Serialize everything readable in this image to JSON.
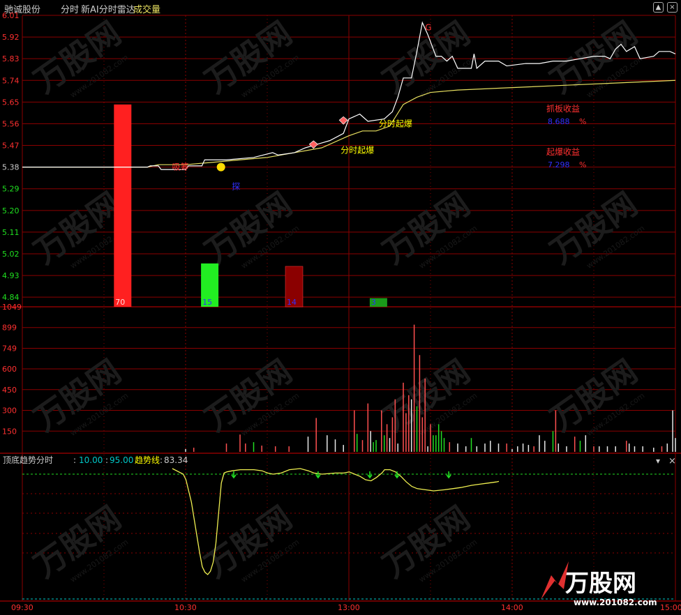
{
  "header": {
    "stock_name": "驰诚股份",
    "mode": "分时",
    "indicator": "新AI分时雷达",
    "volume_label": "成交量"
  },
  "colors": {
    "background": "#000000",
    "grid": "#8b0000",
    "price_line": "#ffffff",
    "avg_line": "#e8e060",
    "up": "#ff2020",
    "down": "#22dd22",
    "label_red": "#ff3030",
    "label_green": "#20e020",
    "label_blue": "#3030ff",
    "text_gray": "#cccccc",
    "cyan": "#00c8c8",
    "yellow": "#ffff00",
    "indicator_line": "#f0f050"
  },
  "watermark": {
    "logo_text": "万股网",
    "url_text": "www.201082.com"
  },
  "chart_data": [
    {
      "type": "line",
      "name": "price_panel",
      "y_ticks": [
        "6.01",
        "5.92",
        "5.83",
        "5.74",
        "5.65",
        "5.56",
        "5.47",
        "5.38",
        "5.29",
        "5.20",
        "5.11",
        "5.02",
        "4.93",
        "4.84"
      ],
      "y_tick_values": [
        6.01,
        5.92,
        5.83,
        5.74,
        5.65,
        5.56,
        5.47,
        5.38,
        5.29,
        5.2,
        5.11,
        5.02,
        4.93,
        4.84
      ],
      "ylim": [
        4.8,
        6.01
      ],
      "base_price": 5.38,
      "x_range": [
        0,
        240
      ],
      "series": [
        {
          "name": "price",
          "points": [
            [
              0,
              5.38
            ],
            [
              40,
              5.38
            ],
            [
              46,
              5.38
            ],
            [
              47,
              5.385
            ],
            [
              50,
              5.385
            ],
            [
              51,
              5.37
            ],
            [
              54,
              5.37
            ],
            [
              60,
              5.37
            ],
            [
              61,
              5.385
            ],
            [
              66,
              5.385
            ],
            [
              67,
              5.41
            ],
            [
              75,
              5.41
            ],
            [
              85,
              5.42
            ],
            [
              92,
              5.44
            ],
            [
              94,
              5.43
            ],
            [
              100,
              5.44
            ],
            [
              104,
              5.46
            ],
            [
              110,
              5.48
            ],
            [
              113,
              5.49
            ],
            [
              118,
              5.52
            ],
            [
              120,
              5.58
            ],
            [
              124,
              5.6
            ],
            [
              127,
              5.57
            ],
            [
              133,
              5.58
            ],
            [
              136,
              5.61
            ],
            [
              138,
              5.67
            ],
            [
              140,
              5.75
            ],
            [
              143,
              5.75
            ],
            [
              145,
              5.86
            ],
            [
              146,
              5.92
            ],
            [
              147,
              5.98
            ],
            [
              149,
              5.93
            ],
            [
              150,
              5.9
            ],
            [
              152,
              5.84
            ],
            [
              154,
              5.84
            ],
            [
              156,
              5.82
            ],
            [
              158,
              5.84
            ],
            [
              160,
              5.79
            ],
            [
              165,
              5.79
            ],
            [
              166,
              5.85
            ],
            [
              167,
              5.79
            ],
            [
              170,
              5.82
            ],
            [
              175,
              5.82
            ],
            [
              178,
              5.8
            ],
            [
              185,
              5.81
            ],
            [
              190,
              5.81
            ],
            [
              195,
              5.82
            ],
            [
              200,
              5.82
            ],
            [
              205,
              5.83
            ],
            [
              210,
              5.84
            ],
            [
              214,
              5.84
            ],
            [
              216,
              5.83
            ],
            [
              218,
              5.87
            ],
            [
              220,
              5.89
            ],
            [
              222,
              5.86
            ],
            [
              225,
              5.88
            ],
            [
              227,
              5.83
            ],
            [
              232,
              5.84
            ],
            [
              234,
              5.86
            ],
            [
              238,
              5.86
            ],
            [
              240,
              5.85
            ]
          ]
        },
        {
          "name": "average",
          "points": [
            [
              0,
              5.38
            ],
            [
              46,
              5.38
            ],
            [
              50,
              5.39
            ],
            [
              60,
              5.39
            ],
            [
              70,
              5.4
            ],
            [
              80,
              5.41
            ],
            [
              90,
              5.42
            ],
            [
              100,
              5.44
            ],
            [
              110,
              5.46
            ],
            [
              120,
              5.51
            ],
            [
              125,
              5.53
            ],
            [
              130,
              5.53
            ],
            [
              135,
              5.55
            ],
            [
              140,
              5.64
            ],
            [
              145,
              5.67
            ],
            [
              150,
              5.69
            ],
            [
              160,
              5.7
            ],
            [
              180,
              5.71
            ],
            [
              200,
              5.72
            ],
            [
              220,
              5.73
            ],
            [
              240,
              5.74
            ]
          ]
        }
      ],
      "signal_bars": [
        {
          "x": 37,
          "value": 70,
          "label": "70",
          "color": "#ff2020"
        },
        {
          "x": 69,
          "value": 15,
          "label": "15",
          "color": "#22ee22"
        },
        {
          "x": 100,
          "value": 14,
          "label": "14",
          "color": "#8b0000"
        },
        {
          "x": 131,
          "value": 3,
          "label": "3",
          "color": "#1a9a1a"
        }
      ],
      "annotations": [
        {
          "text": "吸筹",
          "x": 55,
          "y": 5.38,
          "color": "#ff3030"
        },
        {
          "text": "探",
          "x": 77,
          "y": 5.3,
          "color": "#3030ff"
        },
        {
          "text": "分时起爆",
          "x": 117,
          "y": 5.45,
          "color": "#ffff00"
        },
        {
          "text": "分时起爆",
          "x": 131,
          "y": 5.56,
          "color": "#ffff00"
        },
        {
          "text": "G",
          "x": 148,
          "y": 5.96,
          "color": "#ff3030"
        }
      ],
      "stats": [
        {
          "label": "抓板收益",
          "value": "8.688",
          "unit": "%"
        },
        {
          "label": "起爆收益",
          "value": "7.298",
          "unit": "%"
        }
      ]
    },
    {
      "type": "bar",
      "name": "volume_panel",
      "y_ticks": [
        "1049",
        "899",
        "749",
        "600",
        "450",
        "300",
        "150"
      ],
      "y_tick_values": [
        1049,
        899,
        749,
        600,
        450,
        300,
        150
      ],
      "ylim": [
        0,
        1049
      ],
      "bars": [
        [
          60,
          20,
          "w"
        ],
        [
          63,
          30,
          "r"
        ],
        [
          75,
          60,
          "r"
        ],
        [
          80,
          125,
          "r"
        ],
        [
          82,
          60,
          "r"
        ],
        [
          85,
          70,
          "g"
        ],
        [
          88,
          45,
          "r"
        ],
        [
          93,
          40,
          "r"
        ],
        [
          98,
          40,
          "r"
        ],
        [
          105,
          110,
          "w"
        ],
        [
          108,
          245,
          "r"
        ],
        [
          112,
          120,
          "w"
        ],
        [
          115,
          90,
          "w"
        ],
        [
          118,
          50,
          "w"
        ],
        [
          122,
          300,
          "r"
        ],
        [
          123,
          130,
          "g"
        ],
        [
          125,
          85,
          "r"
        ],
        [
          127,
          350,
          "r"
        ],
        [
          128,
          150,
          "w"
        ],
        [
          129,
          70,
          "g"
        ],
        [
          130,
          85,
          "g"
        ],
        [
          132,
          300,
          "r"
        ],
        [
          133,
          120,
          "g"
        ],
        [
          134,
          200,
          "r"
        ],
        [
          135,
          100,
          "w"
        ],
        [
          136,
          250,
          "r"
        ],
        [
          137,
          380,
          "r"
        ],
        [
          138,
          60,
          "w"
        ],
        [
          140,
          500,
          "r"
        ],
        [
          141,
          280,
          "r"
        ],
        [
          142,
          410,
          "r"
        ],
        [
          143,
          380,
          "w"
        ],
        [
          144,
          920,
          "r"
        ],
        [
          145,
          330,
          "g"
        ],
        [
          146,
          700,
          "r"
        ],
        [
          147,
          250,
          "r"
        ],
        [
          148,
          530,
          "r"
        ],
        [
          149,
          40,
          "w"
        ],
        [
          150,
          200,
          "r"
        ],
        [
          151,
          120,
          "g"
        ],
        [
          152,
          120,
          "g"
        ],
        [
          153,
          200,
          "g"
        ],
        [
          154,
          150,
          "g"
        ],
        [
          155,
          100,
          "g"
        ],
        [
          157,
          70,
          "r"
        ],
        [
          160,
          60,
          "w"
        ],
        [
          163,
          40,
          "w"
        ],
        [
          165,
          100,
          "g"
        ],
        [
          167,
          40,
          "w"
        ],
        [
          170,
          60,
          "w"
        ],
        [
          172,
          80,
          "w"
        ],
        [
          175,
          60,
          "w"
        ],
        [
          178,
          60,
          "r"
        ],
        [
          180,
          20,
          "w"
        ],
        [
          182,
          40,
          "w"
        ],
        [
          184,
          60,
          "w"
        ],
        [
          186,
          50,
          "w"
        ],
        [
          188,
          40,
          "r"
        ],
        [
          190,
          120,
          "w"
        ],
        [
          192,
          80,
          "w"
        ],
        [
          195,
          150,
          "g"
        ],
        [
          196,
          300,
          "r"
        ],
        [
          197,
          60,
          "w"
        ],
        [
          200,
          40,
          "w"
        ],
        [
          203,
          110,
          "r"
        ],
        [
          205,
          80,
          "g"
        ],
        [
          207,
          120,
          "w"
        ],
        [
          210,
          40,
          "r"
        ],
        [
          212,
          40,
          "w"
        ],
        [
          215,
          40,
          "w"
        ],
        [
          218,
          40,
          "w"
        ],
        [
          222,
          80,
          "r"
        ],
        [
          223,
          60,
          "w"
        ],
        [
          225,
          40,
          "w"
        ],
        [
          228,
          40,
          "w"
        ],
        [
          232,
          30,
          "w"
        ],
        [
          235,
          40,
          "r"
        ],
        [
          237,
          60,
          "w"
        ],
        [
          239,
          300,
          "w"
        ],
        [
          240,
          100,
          "w"
        ]
      ]
    },
    {
      "type": "line",
      "name": "indicator_panel",
      "title": "顶底趋势分时",
      "params": [
        "10.00",
        "95.00"
      ],
      "trend_label": "趋势线",
      "trend_value": "83.34",
      "ylim": [
        0,
        100
      ],
      "dashed_levels": [
        95,
        0
      ],
      "series": [
        {
          "name": "trend",
          "points": [
            [
              0,
              100
            ],
            [
              4,
              95
            ],
            [
              5,
              90
            ],
            [
              6,
              80
            ],
            [
              7,
              70
            ],
            [
              8,
              55
            ],
            [
              9,
              40
            ],
            [
              10,
              25
            ],
            [
              11,
              12
            ],
            [
              12,
              7
            ],
            [
              13,
              5
            ],
            [
              14,
              8
            ],
            [
              15,
              16
            ],
            [
              16,
              33
            ],
            [
              17,
              60
            ],
            [
              18,
              87
            ],
            [
              19,
              96
            ],
            [
              20,
              97
            ],
            [
              22,
              98
            ],
            [
              25,
              99
            ],
            [
              30,
              99
            ],
            [
              33,
              98
            ],
            [
              35,
              96
            ],
            [
              37,
              95
            ],
            [
              40,
              96
            ],
            [
              43,
              99
            ],
            [
              47,
              100
            ],
            [
              50,
              98
            ],
            [
              52,
              96
            ],
            [
              55,
              95
            ],
            [
              60,
              96
            ],
            [
              63,
              96
            ],
            [
              65,
              97
            ],
            [
              67,
              95
            ],
            [
              69,
              93
            ],
            [
              71,
              90
            ],
            [
              73,
              89
            ],
            [
              75,
              92
            ],
            [
              77,
              96
            ],
            [
              78,
              99
            ],
            [
              80,
              99
            ],
            [
              82,
              97
            ],
            [
              84,
              93
            ],
            [
              86,
              88
            ],
            [
              88,
              84
            ],
            [
              90,
              82
            ],
            [
              93,
              81
            ],
            [
              96,
              80
            ],
            [
              100,
              81
            ],
            [
              103,
              82
            ],
            [
              106,
              83
            ],
            [
              108,
              84
            ],
            [
              110,
              85
            ],
            [
              113,
              86
            ],
            [
              116,
              87
            ],
            [
              119,
              88
            ],
            [
              120,
              88.5
            ]
          ]
        }
      ],
      "arrows_x": [
        70,
        101,
        120,
        130,
        149
      ]
    }
  ],
  "x_axis": {
    "labels": [
      "09:30",
      "10:30",
      "13:00",
      "14:00",
      "15:00"
    ],
    "label_positions": [
      0,
      60,
      120,
      180,
      240
    ]
  }
}
